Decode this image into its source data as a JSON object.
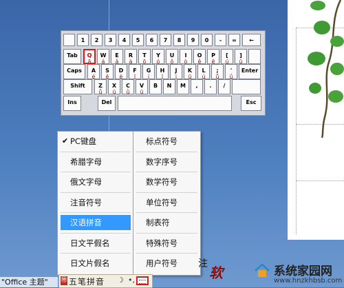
{
  "keyboard": {
    "rows": [
      [
        {
          "l": ""
        },
        {
          "l": "1"
        },
        {
          "l": "2"
        },
        {
          "l": "3"
        },
        {
          "l": "4"
        },
        {
          "l": "5"
        },
        {
          "l": "6"
        },
        {
          "l": "7"
        },
        {
          "l": "8"
        },
        {
          "l": "9"
        },
        {
          "l": "0"
        },
        {
          "l": "-"
        },
        {
          "l": "="
        },
        {
          "l": "←"
        }
      ],
      [
        {
          "l": "Tab"
        },
        {
          "l": "Q",
          "c": "ā"
        },
        {
          "l": "W",
          "c": "á"
        },
        {
          "l": "E",
          "c": "ǎ"
        },
        {
          "l": "R",
          "c": "à"
        },
        {
          "l": "T",
          "c": "ō"
        },
        {
          "l": "Y",
          "c": "ó"
        },
        {
          "l": "U",
          "c": "ǒ"
        },
        {
          "l": "I",
          "c": "ò"
        },
        {
          "l": "O",
          "c": "ê"
        },
        {
          "l": "P",
          "c": "ē"
        },
        {
          "l": "[",
          "c": "ú"
        },
        {
          "l": "]",
          "c": "ǔ"
        },
        {
          "l": ""
        }
      ],
      [
        {
          "l": "Caps"
        },
        {
          "l": "A",
          "c": "é"
        },
        {
          "l": "S",
          "c": "ě"
        },
        {
          "l": "D",
          "c": "è"
        },
        {
          "l": "F",
          "c": "ī"
        },
        {
          "l": "G",
          "c": "í"
        },
        {
          "l": "H",
          "c": "ǐ"
        },
        {
          "l": "J",
          "c": "ì"
        },
        {
          "l": "K",
          "c": "ū"
        },
        {
          "l": "L",
          "c": "ú"
        },
        {
          "l": ";",
          "c": "ǖ"
        },
        {
          "l": "'",
          "c": "ǘ"
        },
        {
          "l": "Enter"
        }
      ],
      [
        {
          "l": "Shift"
        },
        {
          "l": "Z",
          "c": "ǚ"
        },
        {
          "l": "X",
          "c": "ü"
        },
        {
          "l": "C",
          "c": "ǜ"
        },
        {
          "l": "V",
          "c": "ü"
        },
        {
          "l": "B",
          "c": ""
        },
        {
          "l": "N",
          "c": ""
        },
        {
          "l": "M",
          "c": ""
        },
        {
          "l": ",",
          "c": ""
        },
        {
          "l": ".",
          "c": ""
        },
        {
          "l": "/",
          "c": ""
        },
        {
          "l": ""
        }
      ],
      [
        {
          "l": "Ins"
        },
        {
          "l": "Del"
        },
        {
          "l": ""
        },
        {
          "l": "Esc"
        }
      ]
    ]
  },
  "menu_left": {
    "items": [
      {
        "label": "PC键盘",
        "checked": true
      },
      {
        "label": "希腊字母"
      },
      {
        "label": "俄文字母"
      },
      {
        "label": "注音符号"
      },
      {
        "label": "汉语拼音",
        "selected": true
      },
      {
        "label": "日文平假名"
      },
      {
        "label": "日文片假名"
      }
    ]
  },
  "menu_right": {
    "items": [
      {
        "label": "标点符号"
      },
      {
        "label": "数字序号"
      },
      {
        "label": "数学符号"
      },
      {
        "label": "单位符号"
      },
      {
        "label": "制表符"
      },
      {
        "label": "特殊符号"
      },
      {
        "label": "用户符号"
      }
    ]
  },
  "ime": {
    "logo": "㊕",
    "name": "五笔拼音",
    "moon": "☽",
    "punct": "•,"
  },
  "status": {
    "theme_text": "\"Office 主题\"",
    "zhu": "注",
    "ruan": "软"
  },
  "watermark": {
    "title": "系统家园网",
    "url": "www.hnzkhbsb.com"
  },
  "colors": {
    "accent_select": "#3399ff",
    "key_highlight": "#e01818",
    "key_secondary_text": "#8a1010"
  }
}
